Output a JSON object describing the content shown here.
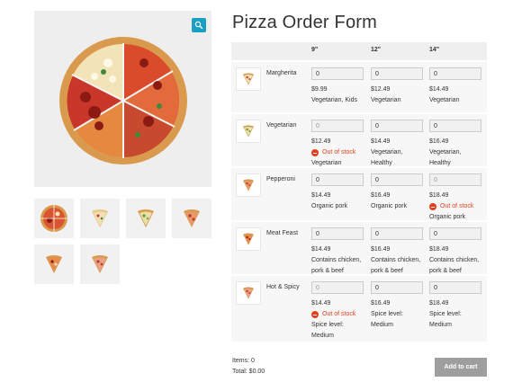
{
  "form": {
    "title": "Pizza Order Form",
    "columns": [
      "9\"",
      "12\"",
      "14\""
    ]
  },
  "products": [
    {
      "name": "Margherita",
      "sizes": [
        {
          "qty": "0",
          "price": "$9.99",
          "info": "Vegetarian, Kids",
          "out_of_stock": false
        },
        {
          "qty": "0",
          "price": "$12.49",
          "info": "Vegetarian",
          "out_of_stock": false
        },
        {
          "qty": "0",
          "price": "$14.49",
          "info": "Vegetarian",
          "out_of_stock": false
        }
      ]
    },
    {
      "name": "Vegetarian",
      "sizes": [
        {
          "qty": "0",
          "price": "$12.49",
          "stock": "Out of stock",
          "info": "Vegetarian",
          "out_of_stock": true
        },
        {
          "qty": "0",
          "price": "$14.49",
          "info": "Vegetarian, Healthy",
          "out_of_stock": false
        },
        {
          "qty": "0",
          "price": "$16.49",
          "info": "Vegetarian, Healthy",
          "out_of_stock": false
        }
      ]
    },
    {
      "name": "Pepperoni",
      "sizes": [
        {
          "qty": "0",
          "price": "$14.49",
          "info": "Organic pork",
          "out_of_stock": false
        },
        {
          "qty": "0",
          "price": "$16.49",
          "info": "Organic pork",
          "out_of_stock": false
        },
        {
          "qty": "0",
          "price": "$18.49",
          "stock": "Out of stock",
          "info": "Organic pork",
          "out_of_stock": true
        }
      ]
    },
    {
      "name": "Meat Feast",
      "sizes": [
        {
          "qty": "0",
          "price": "$14.49",
          "info": "Contains chicken, pork & beef",
          "out_of_stock": false
        },
        {
          "qty": "0",
          "price": "$16.49",
          "info": "Contains chicken, pork & beef",
          "out_of_stock": false
        },
        {
          "qty": "0",
          "price": "$18.49",
          "info": "Contains chicken, pork & beef",
          "out_of_stock": false
        }
      ]
    },
    {
      "name": "Hot & Spicy",
      "sizes": [
        {
          "qty": "0",
          "price": "$14.49",
          "stock": "Out of stock",
          "info": "Spice level: Medium",
          "out_of_stock": true
        },
        {
          "qty": "0",
          "price": "$16.49",
          "info": "Spice level: Medium",
          "out_of_stock": false
        },
        {
          "qty": "0",
          "price": "$18.49",
          "info": "Spice level: Medium",
          "out_of_stock": false
        }
      ]
    }
  ],
  "summary": {
    "items": "Items: 0",
    "total": "Total: $0.00",
    "button": "Add to cart"
  },
  "colors": {
    "accent": "#1a9fc4",
    "out_of_stock": "#e2401c",
    "button": "#9e9e9e"
  },
  "icons": {
    "zoom": "magnifier-icon",
    "stock": "minus-circle-icon"
  }
}
